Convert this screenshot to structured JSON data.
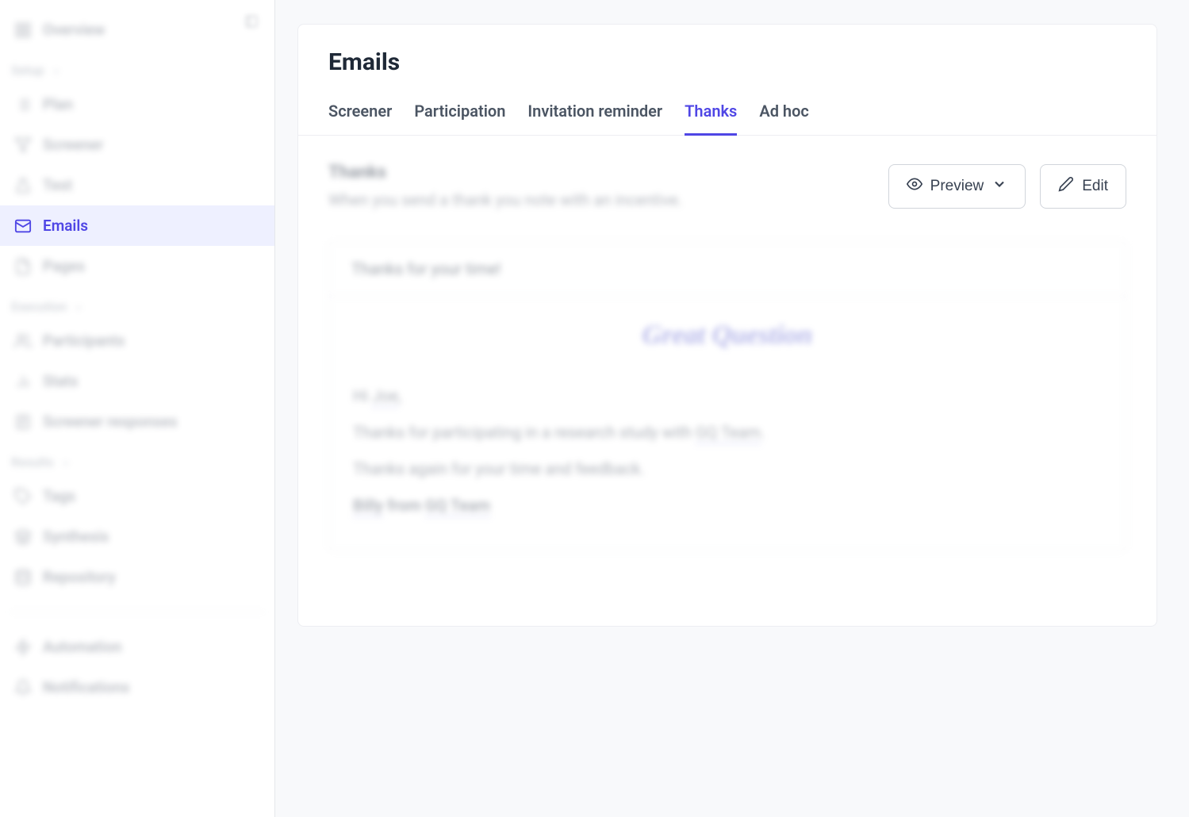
{
  "sidebar": {
    "overview": "Overview",
    "sections": {
      "setup": {
        "label": "Setup",
        "items": [
          "Plan",
          "Screener",
          "Test",
          "Emails",
          "Pages"
        ]
      },
      "execution": {
        "label": "Execution",
        "items": [
          "Participants",
          "Stats",
          "Screener responses"
        ]
      },
      "results": {
        "label": "Results",
        "items": [
          "Tags",
          "Synthesis",
          "Repository"
        ]
      }
    },
    "footer": [
      "Automation",
      "Notifications"
    ]
  },
  "header": {
    "title": "Emails",
    "tabs": [
      "Screener",
      "Participation",
      "Invitation reminder",
      "Thanks",
      "Ad hoc"
    ],
    "active_tab": "Thanks"
  },
  "panel": {
    "title": "Thanks",
    "description": "When you send a thank you note with an incentive.",
    "actions": {
      "preview": "Preview",
      "edit": "Edit"
    }
  },
  "email": {
    "subject": "Thanks for your time!",
    "brand": "Great Question",
    "greeting_prefix": "Hi ",
    "greeting_name": "Joe",
    "greeting_suffix": ",",
    "line1_prefix": "Thanks for participating in a research study with ",
    "line1_team": "GQ Team",
    "line1_suffix": ".",
    "line2": "Thanks again for your time and feedback.",
    "sign_name": "Billy",
    "sign_mid": " from ",
    "sign_team": "GQ Team"
  }
}
